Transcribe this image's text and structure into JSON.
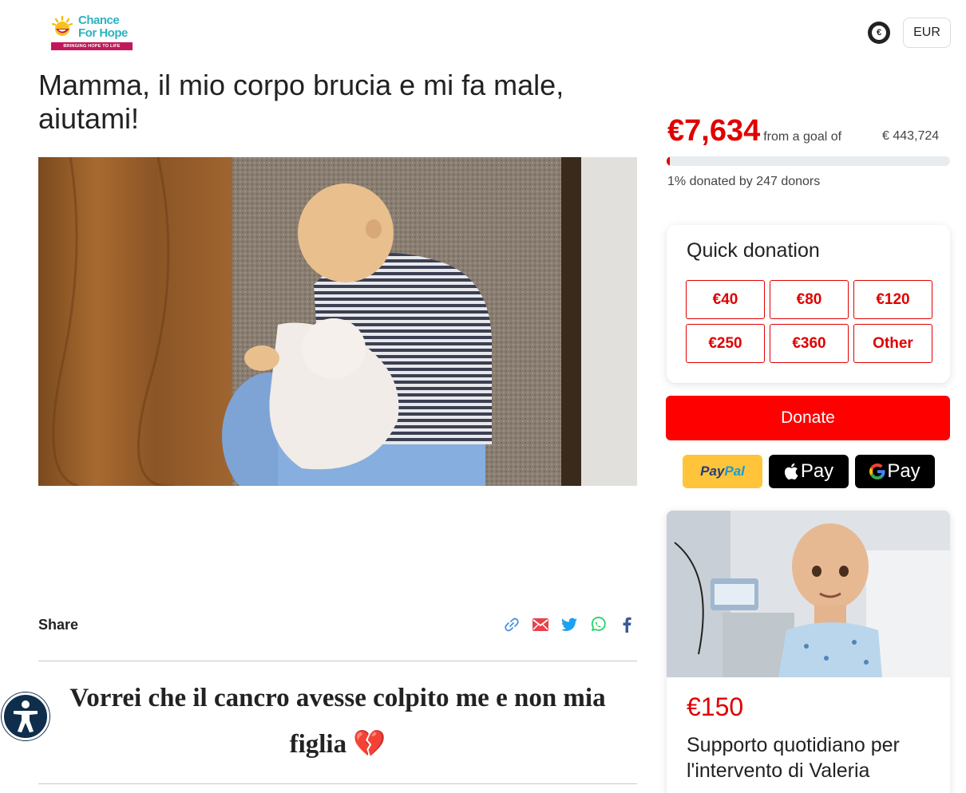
{
  "logo": {
    "line1": "Chance",
    "line2": "For Hope",
    "tagline": "BRINGING HOPE TO LIFE"
  },
  "header": {
    "currency_symbol": "€",
    "currency_code": "EUR"
  },
  "campaign": {
    "title": "Mamma, il mio corpo brucia e mi fa male, aiutami!",
    "hero_image": "sleeping-child-with-teddy-bear"
  },
  "fundraising": {
    "raised": "€7,634",
    "from_text": "from a goal of",
    "goal": "€ 443,724",
    "progress_percent": 1,
    "donors_text": "1% donated by 247 donors"
  },
  "quick_donation": {
    "title": "Quick donation",
    "amounts": [
      "€40",
      "€80",
      "€120",
      "€250",
      "€360",
      "Other"
    ]
  },
  "donate_button": "Donate",
  "payment": {
    "paypal_a": "Pay",
    "paypal_b": "Pal",
    "apple": "Pay",
    "google": "Pay"
  },
  "share": {
    "label": "Share",
    "icons": [
      "link-icon",
      "email-icon",
      "twitter-icon",
      "whatsapp-icon",
      "facebook-icon"
    ]
  },
  "story": {
    "heading": "Vorrei che il cancro avesse colpito me e non mia figlia 💔"
  },
  "reward": {
    "amount": "€150",
    "description": "Supporto quotidiano per l'intervento di Valeria"
  },
  "colors": {
    "accent": "#e00000",
    "donate": "#ff0000",
    "brand": "#2bb3c0",
    "accessibility": "#0f2e4b"
  }
}
